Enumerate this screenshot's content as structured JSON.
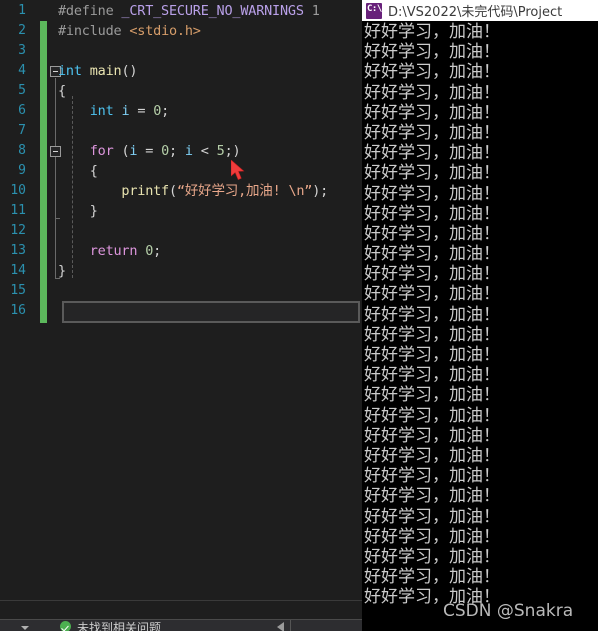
{
  "editor": {
    "line_numbers": [
      "1",
      "2",
      "3",
      "4",
      "5",
      "6",
      "7",
      "8",
      "9",
      "10",
      "11",
      "12",
      "13",
      "14",
      "15",
      "16"
    ],
    "lines": [
      {
        "n": 1,
        "tokens": [
          {
            "t": "#define ",
            "c": "tok-pre"
          },
          {
            "t": "_CRT_SECURE_NO_WARNINGS",
            "c": "tok-macro"
          },
          {
            "t": " 1",
            "c": "tok-num-g"
          }
        ]
      },
      {
        "n": 2,
        "tokens": [
          {
            "t": "#include ",
            "c": "tok-pre"
          },
          {
            "t": "<stdio.h>",
            "c": "tok-inc"
          }
        ]
      },
      {
        "n": 3,
        "tokens": []
      },
      {
        "n": 4,
        "tokens": [
          {
            "t": "int",
            "c": "tok-kw"
          },
          {
            "t": " ",
            "c": "tok-punct"
          },
          {
            "t": "main",
            "c": "tok-fn"
          },
          {
            "t": "()",
            "c": "tok-punct"
          }
        ]
      },
      {
        "n": 5,
        "tokens": [
          {
            "t": "{",
            "c": "tok-brace"
          }
        ]
      },
      {
        "n": 6,
        "tokens": [
          {
            "t": "    ",
            "c": "tok-punct"
          },
          {
            "t": "int",
            "c": "tok-kw"
          },
          {
            "t": " ",
            "c": "tok-punct"
          },
          {
            "t": "i",
            "c": "tok-var"
          },
          {
            "t": " = ",
            "c": "tok-punct"
          },
          {
            "t": "0",
            "c": "tok-lit"
          },
          {
            "t": ";",
            "c": "tok-punct"
          }
        ]
      },
      {
        "n": 7,
        "tokens": []
      },
      {
        "n": 8,
        "tokens": [
          {
            "t": "    ",
            "c": "tok-punct"
          },
          {
            "t": "for",
            "c": "tok-ctrl"
          },
          {
            "t": " (",
            "c": "tok-punct"
          },
          {
            "t": "i",
            "c": "tok-var"
          },
          {
            "t": " = ",
            "c": "tok-punct"
          },
          {
            "t": "0",
            "c": "tok-lit"
          },
          {
            "t": "; ",
            "c": "tok-punct"
          },
          {
            "t": "i",
            "c": "tok-var"
          },
          {
            "t": " < ",
            "c": "tok-punct"
          },
          {
            "t": "5",
            "c": "tok-lit"
          },
          {
            "t": ";)",
            "c": "tok-punct"
          }
        ]
      },
      {
        "n": 9,
        "tokens": [
          {
            "t": "    {",
            "c": "tok-brace"
          }
        ]
      },
      {
        "n": 10,
        "tokens": [
          {
            "t": "        ",
            "c": "tok-punct"
          },
          {
            "t": "printf",
            "c": "tok-fn"
          },
          {
            "t": "(",
            "c": "tok-punct"
          },
          {
            "t": "“好好学习,加油! \\n”",
            "c": "tok-str"
          },
          {
            "t": ");",
            "c": "tok-punct"
          }
        ]
      },
      {
        "n": 11,
        "tokens": [
          {
            "t": "    }",
            "c": "tok-brace"
          }
        ]
      },
      {
        "n": 12,
        "tokens": []
      },
      {
        "n": 13,
        "tokens": [
          {
            "t": "    ",
            "c": "tok-punct"
          },
          {
            "t": "return",
            "c": "tok-ctrl"
          },
          {
            "t": " ",
            "c": "tok-punct"
          },
          {
            "t": "0",
            "c": "tok-lit"
          },
          {
            "t": ";",
            "c": "tok-punct"
          }
        ]
      },
      {
        "n": 14,
        "tokens": [
          {
            "t": "}",
            "c": "tok-brace"
          }
        ]
      },
      {
        "n": 15,
        "tokens": []
      },
      {
        "n": 16,
        "tokens": []
      }
    ],
    "suggest_box_value": "",
    "colors": {
      "background": "#1e1e1e",
      "line_number": "#2b91af",
      "change_bar": "#5cb85c",
      "keyword": "#4ec3f0",
      "control": "#dd96dd",
      "function": "#e8e3b0",
      "string": "#e8a78a",
      "number": "#b5cea8",
      "macro": "#b9a0e8",
      "include": "#d69d6a",
      "preproc": "#9b9b9b"
    }
  },
  "status_bar": {
    "icon": "check-circle-icon",
    "message": "未找到相关问题",
    "dropdown_icon": "chevron-down-icon",
    "nav_icon": "nav-left-icon"
  },
  "console": {
    "icon": "console-app-icon",
    "title": "D:\\VS2022\\未完代码\\Project",
    "output_line": "好好学习，加油！",
    "output_line_count": 29,
    "colors": {
      "background": "#000000",
      "text": "#cccccc",
      "titlebar": "#ffffff",
      "icon": "#68217a"
    }
  },
  "watermark": {
    "text": "CSDN @Snakra"
  }
}
